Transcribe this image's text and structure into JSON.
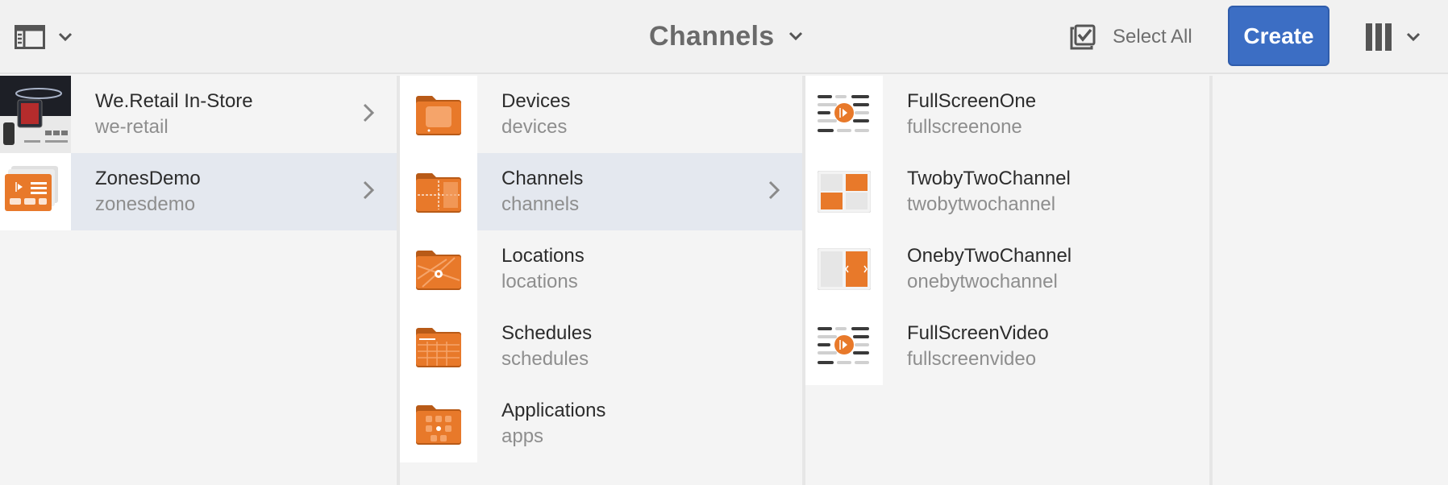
{
  "header": {
    "title": "Channels",
    "select_all_label": "Select All",
    "create_label": "Create",
    "rail_toggle_icon": "rail-toggle-icon",
    "view_icon": "column-view-icon"
  },
  "columns": [
    {
      "items": [
        {
          "title": "We.Retail In-Store",
          "name": "we-retail",
          "thumb": "retail-photo",
          "selected": false,
          "has_children": true
        },
        {
          "title": "ZonesDemo",
          "name": "zonesdemo",
          "thumb": "project-thumbnail",
          "selected": true,
          "has_children": true
        }
      ]
    },
    {
      "items": [
        {
          "title": "Devices",
          "name": "devices",
          "thumb": "devices-folder-icon",
          "selected": false,
          "has_children": false
        },
        {
          "title": "Channels",
          "name": "channels",
          "thumb": "channels-folder-icon",
          "selected": true,
          "has_children": true
        },
        {
          "title": "Locations",
          "name": "locations",
          "thumb": "locations-folder-icon",
          "selected": false,
          "has_children": false
        },
        {
          "title": "Schedules",
          "name": "schedules",
          "thumb": "schedules-folder-icon",
          "selected": false,
          "has_children": false
        },
        {
          "title": "Applications",
          "name": "apps",
          "thumb": "apps-folder-icon",
          "selected": false,
          "has_children": false
        }
      ]
    },
    {
      "items": [
        {
          "title": "FullScreenOne",
          "name": "fullscreenone",
          "thumb": "fullscreen-channel-icon",
          "selected": false,
          "has_children": false
        },
        {
          "title": "TwobyTwoChannel",
          "name": "twobytwochannel",
          "thumb": "grid-2x2-channel-icon",
          "selected": false,
          "has_children": false
        },
        {
          "title": "OnebyTwoChannel",
          "name": "onebytwochannel",
          "thumb": "split-1x2-channel-icon",
          "selected": false,
          "has_children": false
        },
        {
          "title": "FullScreenVideo",
          "name": "fullscreenvideo",
          "thumb": "fullscreen-video-icon",
          "selected": false,
          "has_children": false
        }
      ]
    }
  ],
  "colors": {
    "accent": "#3c6ec4",
    "folder_orange": "#e8792a",
    "selected_row": "#e4e8ef"
  }
}
